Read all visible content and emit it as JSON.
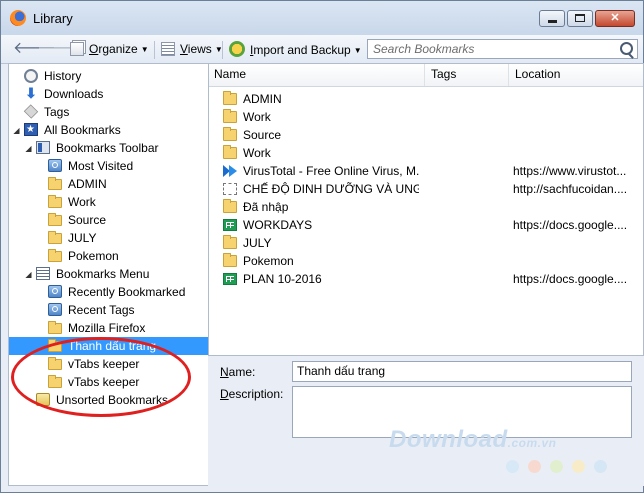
{
  "window": {
    "title": "Library"
  },
  "toolbar": {
    "organize_label": "Organize",
    "organize_mnemonic": "O",
    "views_label": "Views",
    "views_mnemonic": "V",
    "import_label": "Import and Backup",
    "import_mnemonic": "I",
    "search_placeholder": "Search Bookmarks"
  },
  "tree": {
    "history": "History",
    "downloads": "Downloads",
    "tags": "Tags",
    "all_bookmarks": "All Bookmarks",
    "bookmarks_toolbar": "Bookmarks Toolbar",
    "toolbar_items": [
      "Most Visited",
      "ADMIN",
      "Work",
      "Source",
      "JULY",
      "Pokemon"
    ],
    "bookmarks_menu": "Bookmarks Menu",
    "menu_items": [
      "Recently Bookmarked",
      "Recent Tags",
      "Mozilla Firefox",
      "Thanh dấu trang",
      "vTabs keeper",
      "vTabs keeper"
    ],
    "unsorted": "Unsorted Bookmarks"
  },
  "list": {
    "columns": [
      "Name",
      "Tags",
      "Location"
    ],
    "rows": [
      {
        "icon": "folder-icon",
        "name": "ADMIN",
        "location": ""
      },
      {
        "icon": "folder-icon",
        "name": "Work",
        "location": ""
      },
      {
        "icon": "folder-icon",
        "name": "Source",
        "location": ""
      },
      {
        "icon": "folder-icon",
        "name": "Work",
        "location": ""
      },
      {
        "icon": "virustotal-icon",
        "name": "VirusTotal - Free Online Virus, M...",
        "location": "https://www.virustot..."
      },
      {
        "icon": "page-icon",
        "name": "CHẾ ĐỘ DINH DƯỠNG VÀ UNG ...",
        "location": "http://sachfucoidan...."
      },
      {
        "icon": "folder-icon",
        "name": "Đã nhập",
        "location": ""
      },
      {
        "icon": "sheet-icon",
        "name": "WORKDAYS",
        "location": "https://docs.google...."
      },
      {
        "icon": "folder-icon",
        "name": "JULY",
        "location": ""
      },
      {
        "icon": "folder-icon",
        "name": "Pokemon",
        "location": ""
      },
      {
        "icon": "sheet-icon",
        "name": "PLAN 10-2016",
        "location": "https://docs.google...."
      }
    ]
  },
  "details": {
    "name_label": "Name:",
    "name_mnemonic": "N",
    "name_value": "Thanh dấu trang",
    "description_label": "Description:",
    "description_mnemonic": "D"
  },
  "watermark": {
    "text": "Download",
    "domain": ".com.vn"
  },
  "colors": {
    "selection": "#3399ff",
    "highlight_circle": "#e01f1f"
  }
}
